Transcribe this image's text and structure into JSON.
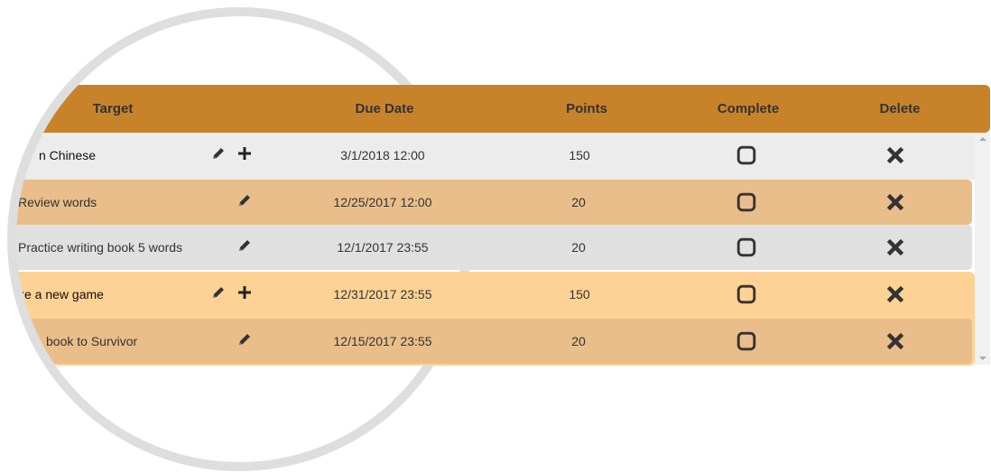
{
  "header": {
    "target": "Target",
    "due_date": "Due Date",
    "points": "Points",
    "complete": "Complete",
    "delete": "Delete"
  },
  "rows": [
    {
      "target": "n Chinese",
      "due": "3/1/2018 12:00",
      "points": "150",
      "has_add": true
    },
    {
      "target": "Review words",
      "due": "12/25/2017 12:00",
      "points": "20",
      "has_add": false
    },
    {
      "target": "Practice writing book 5 words",
      "due": "12/1/2017 23:55",
      "points": "20",
      "has_add": false
    },
    {
      "target": "ke a new game",
      "due": "12/31/2017 23:55",
      "points": "150",
      "has_add": true
    },
    {
      "target": "book to Survivor",
      "due": "12/15/2017 23:55",
      "points": "20",
      "has_add": false
    }
  ],
  "colors": {
    "header": "#c8832a",
    "row_gray": "#ececec",
    "row_child": "#e9be8a",
    "row_gray2": "#e0e0e0",
    "row_highlight": "#fdd294",
    "ring": "#dddddd"
  }
}
